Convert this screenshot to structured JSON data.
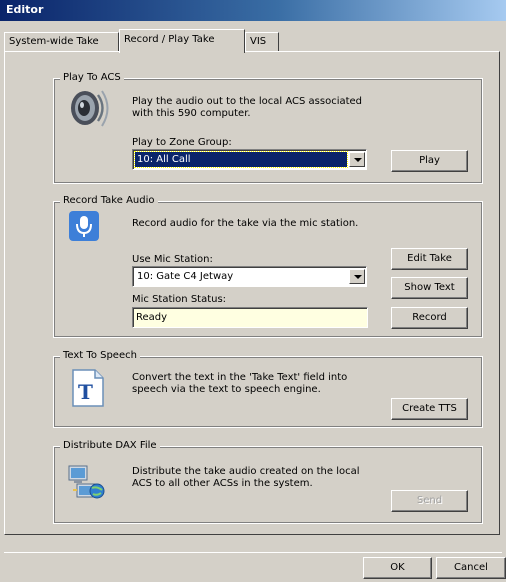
{
  "window": {
    "title": "Editor"
  },
  "tabs": [
    {
      "label": "System-wide Take"
    },
    {
      "label": "Record / Play Take"
    },
    {
      "label": "VIS"
    }
  ],
  "play_to_acs": {
    "legend": "Play To ACS",
    "description": "Play the audio out to the local ACS associated with this 590 computer.",
    "zone_group_label": "Play to Zone Group:",
    "zone_group_value": "10: All Call",
    "play_button": "Play",
    "icon": "speaker-icon"
  },
  "record_take_audio": {
    "legend": "Record Take Audio",
    "description": "Record audio for the take via the mic station.",
    "mic_station_label": "Use Mic Station:",
    "mic_station_value": "10: Gate C4 Jetway",
    "mic_status_label": "Mic Station Status:",
    "mic_status_value": "Ready",
    "edit_take_button": "Edit Take",
    "show_text_button": "Show Text",
    "record_button": "Record",
    "icon": "microphone-icon"
  },
  "text_to_speech": {
    "legend": "Text To Speech",
    "description": "Convert the text in the 'Take Text' field into speech via the text to speech engine.",
    "create_tts_button": "Create TTS",
    "icon": "text-document-icon"
  },
  "distribute_dax": {
    "legend": "Distribute DAX File",
    "description": "Distribute the take audio created on the local ACS to all other ACSs in the system.",
    "send_button": "Send",
    "icon": "network-computers-icon"
  },
  "footer": {
    "ok_button": "OK",
    "cancel_button": "Cancel"
  },
  "colors": {
    "dialog_bg": "#d4d0c8",
    "title_bar": "#0a246a",
    "selection": "#0a246a",
    "status_field_bg": "#ffffe1",
    "mic_icon_bg": "#3d7fd8"
  }
}
